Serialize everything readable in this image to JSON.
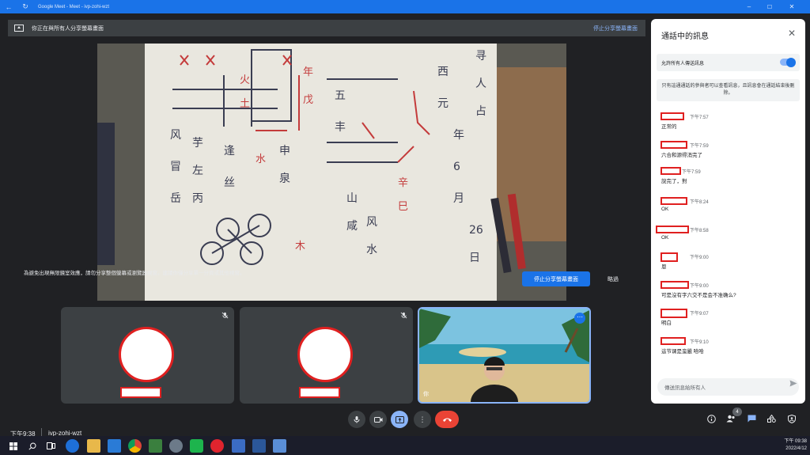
{
  "titlebar": {
    "app_title": "Google Meet - Meet - ivp-zohi-wzt",
    "minimize": "–",
    "maximize": "☐",
    "close": "✕"
  },
  "sharing_bar": {
    "text": "你正在與所有人分享螢幕畫面",
    "stop_link": "停止分享螢幕畫面"
  },
  "warning": {
    "text": "為避免出現無限鏡室效應，請勿分享整個螢幕或瀏覽器視窗。建議你僅分享單一分頁或其他視窗。",
    "stop_button": "停止分享螢幕畫面",
    "ignore_button": "略過"
  },
  "participants": [
    {
      "kind": "avatar",
      "muted": true
    },
    {
      "kind": "avatar",
      "muted": true
    },
    {
      "kind": "camera",
      "label": "你"
    }
  ],
  "bottom_bar": {
    "time": "下午9:38",
    "meeting_code": "ivp-zohi-wzt",
    "people_count": "4"
  },
  "chat": {
    "title": "通話中的訊息",
    "allow_label": "允許所有人傳送訊息",
    "allow_enabled": true,
    "info": "只有這通通話的參與者可以查看訊息，且訊息會在通話結束後刪除。",
    "messages": [
      {
        "time": "下午7:57",
        "text": "正常的"
      },
      {
        "time": "下午7:59",
        "text": "六合和源得消完了"
      },
      {
        "time": "下午7:59",
        "text": "說完了，對"
      },
      {
        "time": "下午8:24",
        "text": "OK"
      },
      {
        "time": "下午8:58",
        "text": "OK"
      },
      {
        "time": "下午9:00",
        "text": "恩"
      },
      {
        "time": "下午9:00",
        "text": "可是沒有字六交不是会不准确么?"
      },
      {
        "time": "下午9:07",
        "text": "明白"
      },
      {
        "time": "下午9:10",
        "text": "這节课是蛮嚴 哈哈"
      }
    ],
    "compose_placeholder": "傳送訊息給所有人"
  },
  "taskbar": {
    "clock_time": "下午 09:38",
    "clock_date": "2022/4/12"
  },
  "colors": {
    "accent": "#1a73e8",
    "redaction": "#e02020",
    "hangup": "#ea4335"
  }
}
